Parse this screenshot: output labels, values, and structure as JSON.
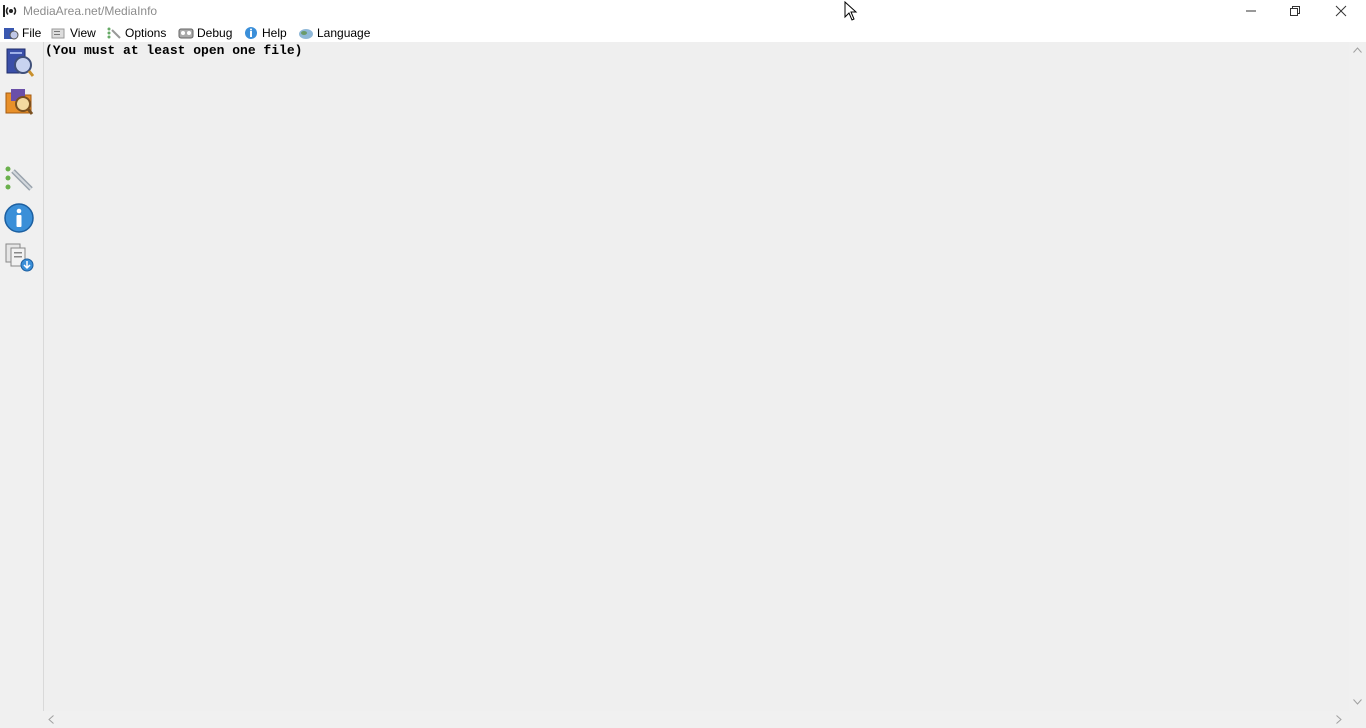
{
  "window": {
    "title": "MediaArea.net/MediaInfo",
    "icon": "mediainfo-app-icon"
  },
  "menu": [
    {
      "label": "File",
      "icon": "file-icon"
    },
    {
      "label": "View",
      "icon": "view-icon"
    },
    {
      "label": "Options",
      "icon": "options-icon"
    },
    {
      "label": "Debug",
      "icon": "debug-icon"
    },
    {
      "label": "Help",
      "icon": "help-icon"
    },
    {
      "label": "Language",
      "icon": "language-icon"
    }
  ],
  "toolbar": [
    {
      "name": "open-file-icon"
    },
    {
      "name": "open-folder-icon"
    },
    {
      "name": "preferences-icon"
    },
    {
      "name": "about-icon"
    },
    {
      "name": "export-icon"
    }
  ],
  "content": {
    "text": "(You must at least open one file)"
  },
  "colors": {
    "background": "#f0f0f0",
    "titlebar": "#ffffff",
    "title_text": "#8c8c8c"
  }
}
